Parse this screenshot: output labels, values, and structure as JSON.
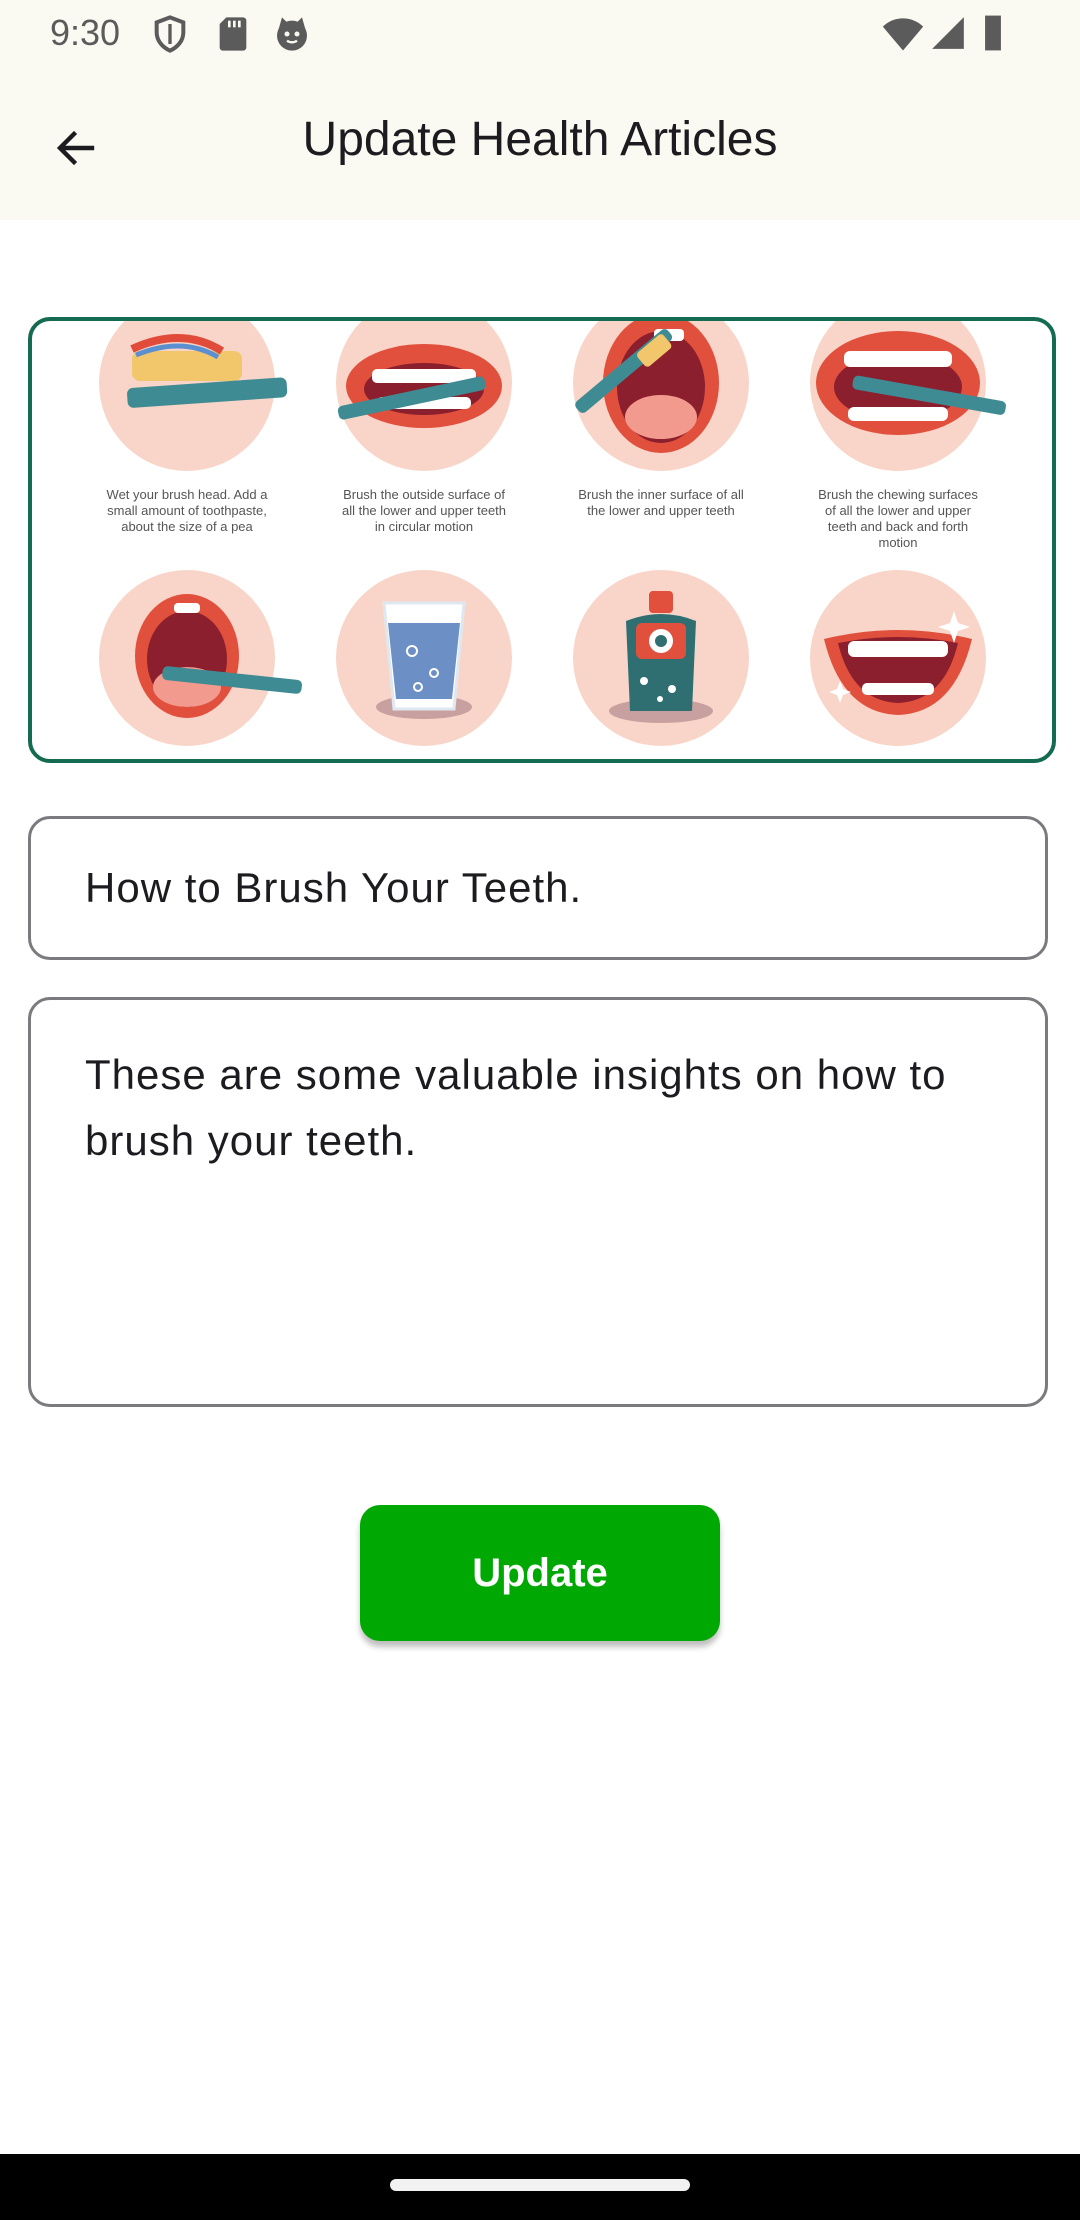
{
  "status_bar": {
    "time": "9:30"
  },
  "header": {
    "title": "Update Health Articles"
  },
  "image": {
    "captions": [
      "Wet your brush head. Add a small amount of toothpaste, about the size of a pea",
      "Brush the outside surface of all the lower and upper teeth in circular motion",
      "Brush the inner surface of all the lower and upper teeth",
      "Brush the chewing surfaces of all the lower and upper teeth and back and forth motion"
    ]
  },
  "form": {
    "title_value": "How to Brush Your Teeth.",
    "description_value": "These are some valuable insights on how to brush your teeth."
  },
  "buttons": {
    "update_label": "Update"
  },
  "colors": {
    "accent_green": "#00a803",
    "border_teal": "#156b52",
    "circle_pink": "#f8d5c8"
  }
}
